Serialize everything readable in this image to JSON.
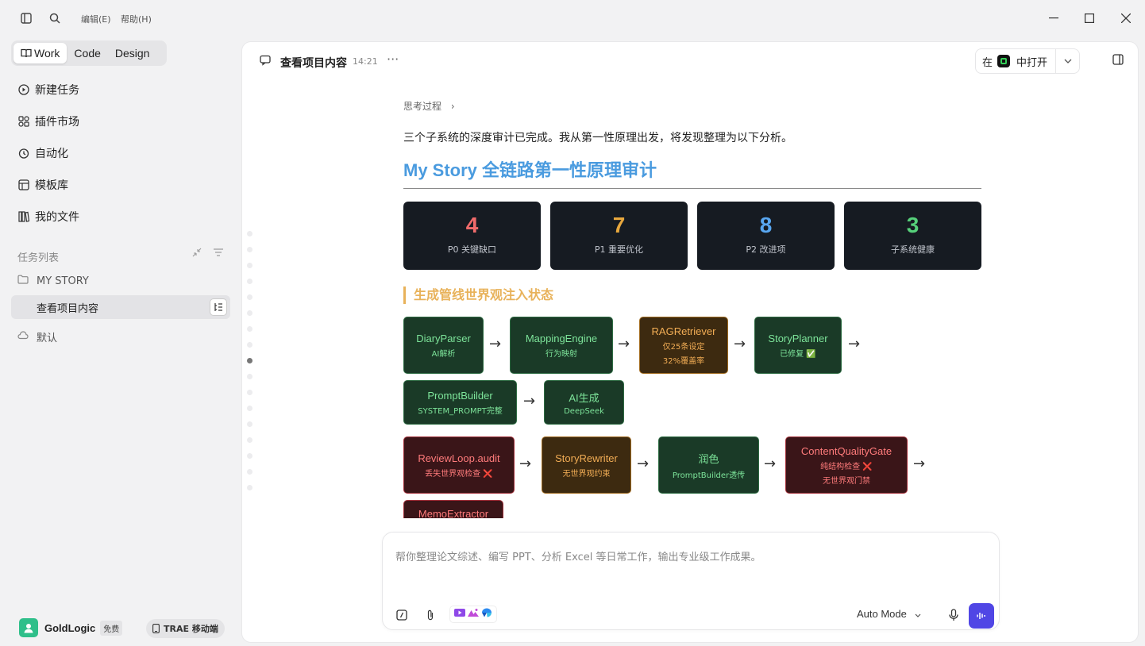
{
  "menus": {
    "edit": "编辑(E)",
    "help": "帮助(H)"
  },
  "modes": [
    "Work",
    "Code",
    "Design"
  ],
  "nav": [
    {
      "label": "新建任务",
      "icon": "new-task-icon"
    },
    {
      "label": "插件市场",
      "icon": "plugin-icon"
    },
    {
      "label": "自动化",
      "icon": "clock-icon"
    },
    {
      "label": "模板库",
      "icon": "template-icon"
    },
    {
      "label": "我的文件",
      "icon": "files-icon"
    }
  ],
  "tasks": {
    "section_label": "任务列表",
    "folder": "MY STORY",
    "active_task": "查看项目内容",
    "default": "默认"
  },
  "user": {
    "name": "GoldLogic",
    "plan": "免费",
    "mobile": "TRAE 移动端"
  },
  "header": {
    "title": "查看项目内容",
    "time": "14:21",
    "more": "···",
    "open_pre": "在",
    "open_post": "中打开"
  },
  "content": {
    "thought": "思考过程",
    "intro": "三个子系统的深度审计已完成。我从第一性原理出发，将发现整理为以下分析。",
    "title": "My Story 全链路第一性原理审计",
    "stats": [
      {
        "value": "4",
        "label": "P0 关键缺口",
        "color": "#f06b6b"
      },
      {
        "value": "7",
        "label": "P1 重要优化",
        "color": "#e8a83e"
      },
      {
        "value": "8",
        "label": "P2 改进项",
        "color": "#58a6f0"
      },
      {
        "value": "3",
        "label": "子系统健康",
        "color": "#56d07a"
      }
    ],
    "pipeline_heading": "生成管线世界观注入状态",
    "nodes": [
      {
        "title": "DiaryParser",
        "sub": "AI解析",
        "sub2": ""
      },
      {
        "title": "MappingEngine",
        "sub": "行为映射",
        "sub2": ""
      },
      {
        "title": "RAGRetriever",
        "sub": "仅25条设定",
        "sub2": "32%覆盖率"
      },
      {
        "title": "StoryPlanner",
        "sub": "已修复 ✅",
        "sub2": ""
      },
      {
        "title": "PromptBuilder",
        "sub": "SYSTEM_PROMPT完整",
        "sub2": ""
      },
      {
        "title": "AI生成",
        "sub": "DeepSeek",
        "sub2": ""
      },
      {
        "title": "ReviewLoop.audit",
        "sub": "丢失世界观检查 ❌",
        "sub2": ""
      },
      {
        "title": "StoryRewriter",
        "sub": "无世界观约束",
        "sub2": ""
      },
      {
        "title": "润色",
        "sub": "PromptBuilder透传",
        "sub2": ""
      },
      {
        "title": "ContentQualityGate",
        "sub": "纯结构检查 ❌",
        "sub2": "无世界观门禁"
      },
      {
        "title": "MemoExtractor",
        "sub": "",
        "sub2": ""
      }
    ],
    "arrow": "→"
  },
  "composer": {
    "placeholder": "帮你整理论文综述、编写 PPT、分析 Excel 等日常工作，输出专业级工作成果。",
    "mode": "Auto Mode"
  }
}
